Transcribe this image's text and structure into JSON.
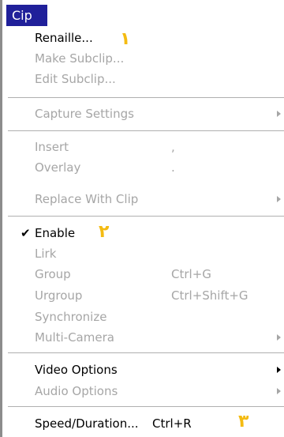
{
  "menu_title": "Cip",
  "annotation_color": "#f4bb12",
  "items": {
    "rename": {
      "label": "Renaille...",
      "badge": "١"
    },
    "make_subclip": {
      "label": "Make Subclip..."
    },
    "edit_subclip": {
      "label": "Edit Subclip..."
    },
    "capture_settings": {
      "label": "Capture Settings"
    },
    "insert": {
      "label": "Insert",
      "shortcut": ","
    },
    "overlay": {
      "label": "Overlay",
      "shortcut": "."
    },
    "replace_with_clip": {
      "label": "Replace With Clip"
    },
    "enable": {
      "label": "Enable",
      "checked": true,
      "badge": "٢"
    },
    "link": {
      "label": "Lirk"
    },
    "group": {
      "label": "Group",
      "shortcut": "Ctrl+G"
    },
    "ungroup": {
      "label": "Urgroup",
      "shortcut": "Ctrl+Shift+G"
    },
    "synchronize": {
      "label": "Synchronize"
    },
    "multi_camera": {
      "label": "Multi-Camera"
    },
    "video_options": {
      "label": "Video Options"
    },
    "audio_options": {
      "label": "Audio Options"
    },
    "speed_duration": {
      "label": "Speed/Duration...",
      "shortcut": "Ctrl+R",
      "badge": "٣"
    }
  }
}
